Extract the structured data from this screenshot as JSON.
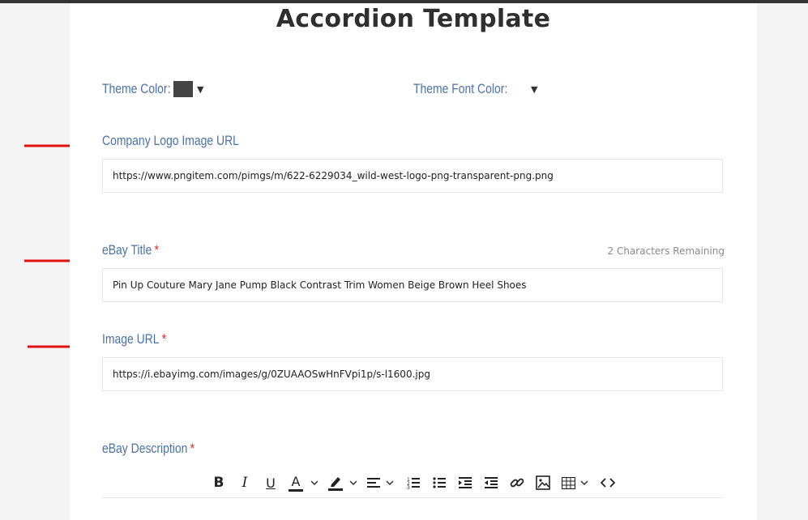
{
  "page": {
    "title": "Accordion Template"
  },
  "theme": {
    "color_label": "Theme Color:",
    "color_value": "#444444",
    "font_color_label": "Theme Font Color:"
  },
  "fields": {
    "logo": {
      "label": "Company Logo Image URL",
      "value": "https://www.pngitem.com/pimgs/m/622-6229034_wild-west-logo-png-transparent-png.png"
    },
    "title": {
      "label": "eBay Title",
      "required": "*",
      "remaining": "2 Characters Remaining",
      "value": "Pin Up Couture Mary Jane Pump Black Contrast Trim Women Beige Brown Heel Shoes"
    },
    "image": {
      "label": "Image URL",
      "required": "*",
      "value": "https://i.ebayimg.com/images/g/0ZUAAOSwHnFVpi1p/s-l1600.jpg"
    },
    "description": {
      "label": "eBay Description",
      "required": "*"
    }
  },
  "toolbar": {
    "bold": "B",
    "italic": "I",
    "underline": "U",
    "font_color": "A",
    "caret": "⌄",
    "icons": [
      "bold-icon",
      "italic-icon",
      "underline-icon",
      "font-color-icon",
      "highlight-icon",
      "align-icon",
      "ordered-list-icon",
      "bullet-list-icon",
      "indent-icon",
      "outdent-icon",
      "link-icon",
      "image-icon",
      "table-icon",
      "code-icon"
    ]
  },
  "colors": {
    "label": "#4a72a8",
    "required": "#e02424",
    "arrow": "#e01010"
  }
}
